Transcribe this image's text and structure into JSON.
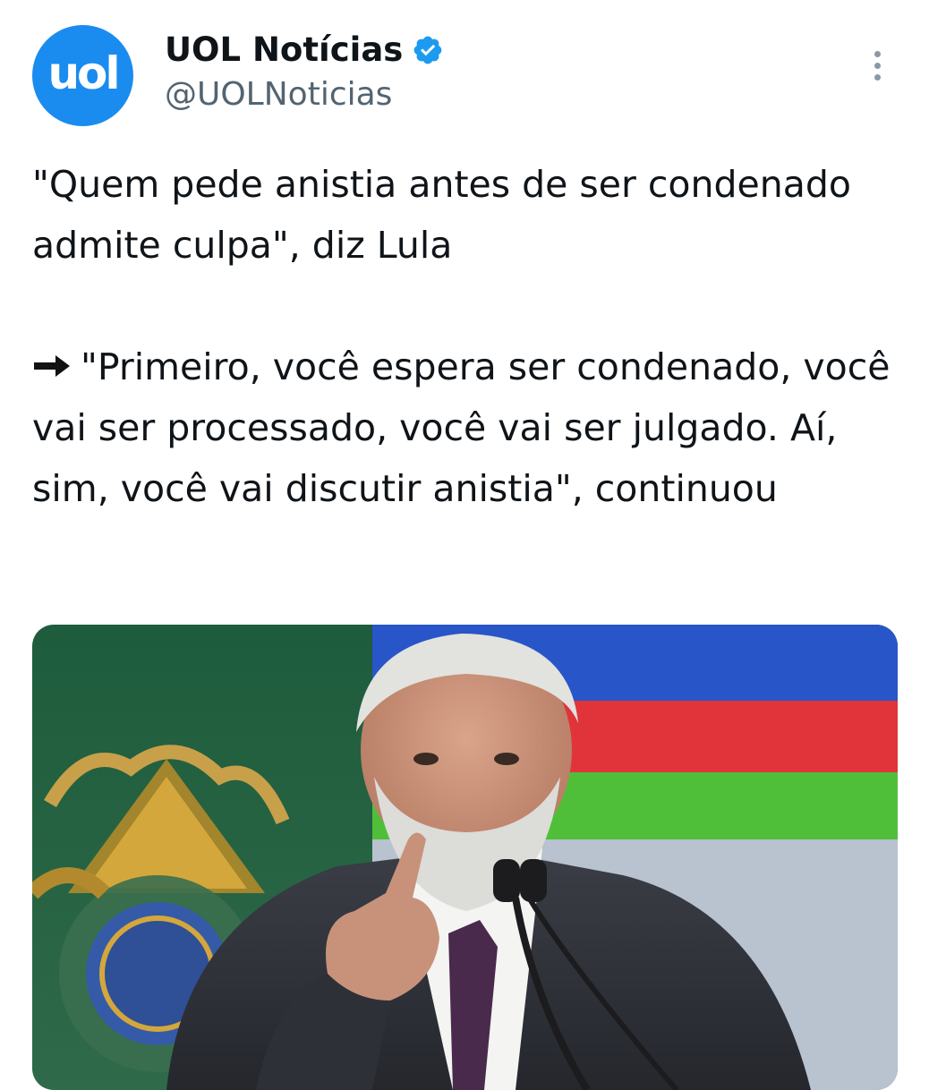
{
  "author": {
    "avatar_text": "uol",
    "display_name": "UOL Notícias",
    "handle": "@UOLNoticias",
    "verified": true,
    "avatar_color": "#1a8cf0",
    "verified_color": "#1d9bf0"
  },
  "tweet": {
    "headline": "\"Quem pede anistia antes de ser condenado admite culpa\", diz Lula",
    "arrow_icon": "right-arrow-icon",
    "quote": "\"Primeiro, você espera ser condenado, você vai ser processado, você vai ser julgado. Aí, sim, você vai discutir anistia\", continuou"
  },
  "media": {
    "kind": "photo",
    "icon": "photo-of-speaker-at-podium"
  },
  "icons": {
    "more": "more-options-icon",
    "verified": "verified-badge-icon"
  }
}
